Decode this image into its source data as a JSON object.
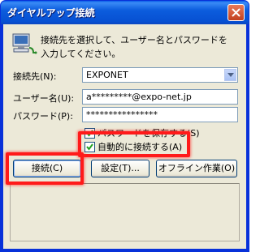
{
  "window": {
    "title": "ダイヤルアップ接続"
  },
  "description": "接続先を選択して、ユーザー名とパスワードを入力してください。",
  "fields": {
    "connect_to": {
      "label": "接続先(N):",
      "value": "EXPONET"
    },
    "username": {
      "label": "ユーザー名(U):",
      "value": "a*********@expo-net.jp"
    },
    "password": {
      "label": "パスワード(P):",
      "value": "****************"
    }
  },
  "checkboxes": {
    "save_password": {
      "label": "パスワードを保存する(S)",
      "checked": true
    },
    "auto_connect": {
      "label": "自動的に接続する(A)",
      "checked": true
    }
  },
  "buttons": {
    "connect": "接続(C)",
    "settings": "設定(T)...",
    "offline": "オフライン作業(O)"
  },
  "colors": {
    "highlight": "#ff1a1a",
    "titlebar": "#0750d2"
  },
  "icons": [
    "network-computer-icon",
    "close-icon",
    "dropdown-arrow-icon",
    "checkmark-icon"
  ]
}
